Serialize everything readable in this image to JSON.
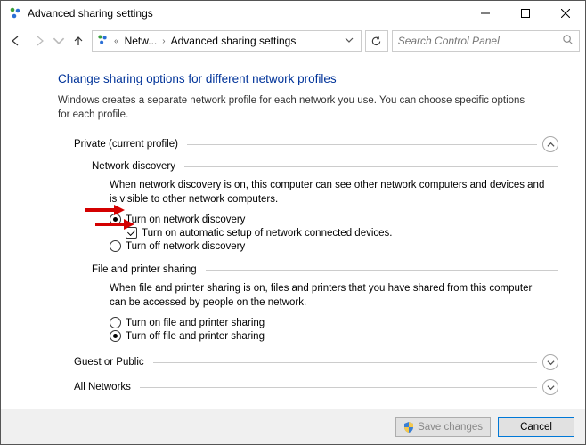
{
  "window": {
    "title": "Advanced sharing settings"
  },
  "breadcrumb": {
    "item1": "Netw...",
    "item2": "Advanced sharing settings"
  },
  "search": {
    "placeholder": "Search Control Panel"
  },
  "heading": "Change sharing options for different network profiles",
  "intro": "Windows creates a separate network profile for each network you use. You can choose specific options for each profile.",
  "sections": {
    "private": {
      "title": "Private (current profile)",
      "network_discovery": {
        "title": "Network discovery",
        "desc": "When network discovery is on, this computer can see other network computers and devices and is visible to other network computers.",
        "opt_on": "Turn on network discovery",
        "opt_auto": "Turn on automatic setup of network connected devices.",
        "opt_off": "Turn off network discovery"
      },
      "file_printer": {
        "title": "File and printer sharing",
        "desc": "When file and printer sharing is on, files and printers that you have shared from this computer can be accessed by people on the network.",
        "opt_on": "Turn on file and printer sharing",
        "opt_off": "Turn off file and printer sharing"
      }
    },
    "guest": {
      "title": "Guest or Public"
    },
    "all": {
      "title": "All Networks"
    }
  },
  "footer": {
    "save": "Save changes",
    "cancel": "Cancel"
  }
}
